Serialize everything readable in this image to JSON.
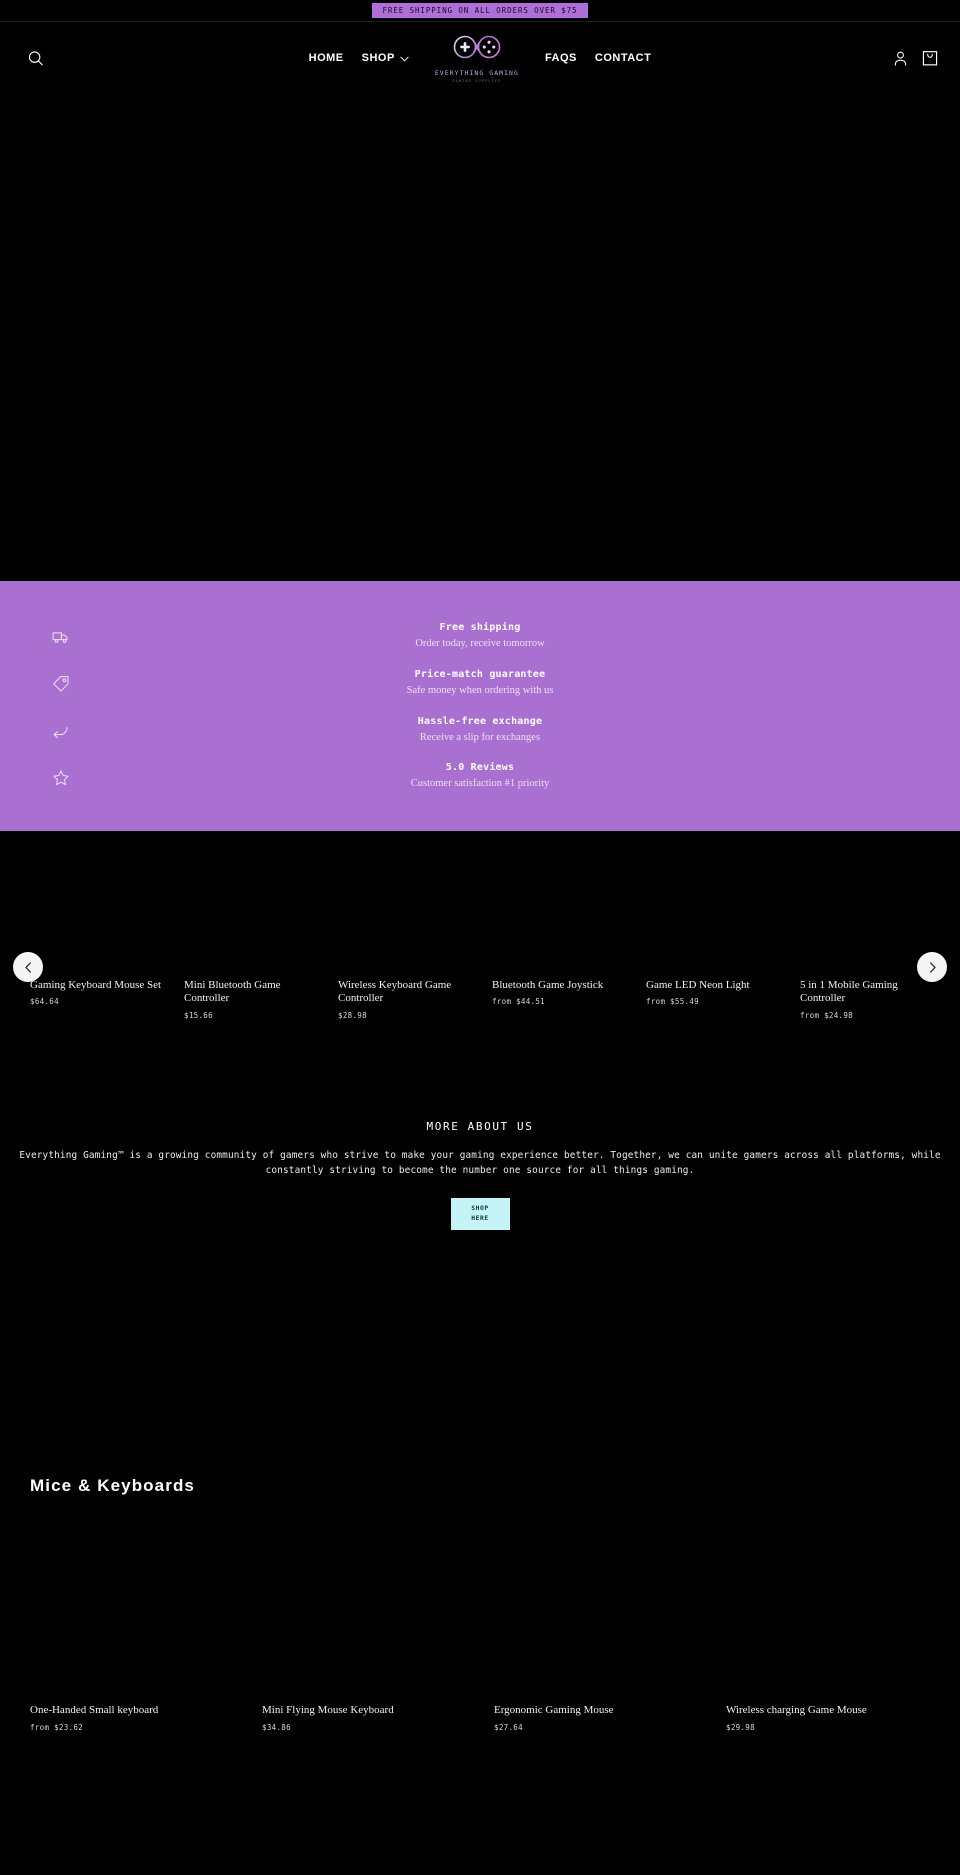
{
  "announcement": {
    "text": "FREE SHIPPING ON ALL ORDERS OVER $75",
    "bg_color": "#b06fd8"
  },
  "header": {
    "search_icon": "search-icon",
    "nav_left": [
      {
        "label": "HOME",
        "name": "home"
      },
      {
        "label": "SHOP",
        "name": "shop",
        "has_dropdown": true
      }
    ],
    "nav_right": [
      {
        "label": "FAQS",
        "name": "faqs"
      },
      {
        "label": "CONTACT",
        "name": "contact"
      }
    ],
    "logo": {
      "name": "EVERYTHING GAMING",
      "tagline": "GAMING SUPPLIES"
    },
    "account_icon": "account-icon",
    "cart_icon": "shopping-bag-icon"
  },
  "benefits": {
    "bg_color": "#a96fd1",
    "items": [
      {
        "icon": "delivery-truck-icon",
        "title": "Free shipping",
        "subtitle": "Order today, receive tomorrow"
      },
      {
        "icon": "price-tag-icon",
        "title": "Price-match guarantee",
        "subtitle": "Safe money when ordering with us"
      },
      {
        "icon": "return-arrow-icon",
        "title": "Hassle-free exchange",
        "subtitle": "Receive a slip for exchanges"
      },
      {
        "icon": "star-icon",
        "title": "5.0 Reviews",
        "subtitle": "Customer satisfaction #1 priority"
      }
    ]
  },
  "carousel": {
    "prev_label": "‹",
    "next_label": "›",
    "products": [
      {
        "title": "Gaming Keyboard Mouse Set",
        "price": "$64.64"
      },
      {
        "title": "Mini Bluetooth Game Controller",
        "price": "$15.66"
      },
      {
        "title": "Wireless Keyboard Game Controller",
        "price": "$28.98"
      },
      {
        "title": "Bluetooth Game Joystick",
        "price": "from $44.51"
      },
      {
        "title": "Game LED Neon Light",
        "price": "from $55.49"
      },
      {
        "title": "5 in 1 Mobile Gaming Controller",
        "price": "from $24.98"
      }
    ]
  },
  "about": {
    "title": "MORE ABOUT US",
    "body": "Everything Gaming™ is a growing community of gamers who strive to make your gaming experience better. Together, we can unite gamers across all platforms, while constantly striving to become the number one source for all things gaming.",
    "button_line1": "SHOP",
    "button_line2": "HERE",
    "button_color": "#c5f4f6"
  },
  "collection": {
    "title": "Mice & Keyboards",
    "products": [
      {
        "title": "One-Handed Small keyboard",
        "price": "from $23.62"
      },
      {
        "title": "Mini Flying Mouse Keyboard",
        "price": "$34.86"
      },
      {
        "title": "Ergonomic Gaming Mouse",
        "price": "$27.64"
      },
      {
        "title": "Wireless charging Game Mouse",
        "price": "$29.98"
      }
    ]
  }
}
